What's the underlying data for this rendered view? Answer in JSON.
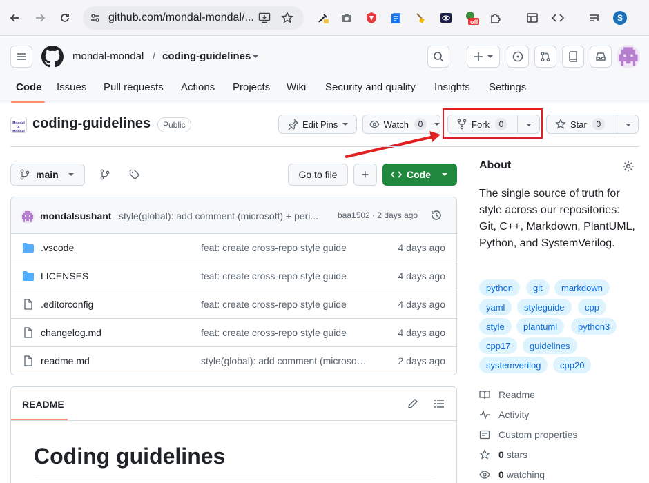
{
  "browser": {
    "url": "github.com/mondal-mondal/...",
    "profile_initial": "S",
    "ext_badge": "off"
  },
  "header": {
    "owner": "mondal-mondal",
    "separator": "/",
    "repo": "coding-guidelines"
  },
  "tabs": [
    {
      "label": "Code"
    },
    {
      "label": "Issues"
    },
    {
      "label": "Pull requests"
    },
    {
      "label": "Actions"
    },
    {
      "label": "Projects"
    },
    {
      "label": "Wiki"
    },
    {
      "label": "Security and quality"
    },
    {
      "label": "Insights"
    },
    {
      "label": "Settings"
    }
  ],
  "repo": {
    "logo_text_1": "Mondal &",
    "logo_text_2": "Mondal",
    "name": "coding-guidelines",
    "visibility": "Public",
    "edit_pins": "Edit Pins",
    "watch": "Watch",
    "watch_count": "0",
    "fork": "Fork",
    "fork_count": "0",
    "star": "Star",
    "star_count": "0"
  },
  "branch_bar": {
    "branch": "main",
    "go_to_file": "Go to file",
    "add": "+",
    "code": "Code"
  },
  "commit": {
    "author": "mondalsushant",
    "message": "style(global): add comment (microsoft) + peri...",
    "meta": "baa1502 · 2 days ago"
  },
  "files": [
    {
      "name": ".vscode",
      "type": "folder",
      "message": "feat: create cross-repo style guide",
      "date": "4 days ago"
    },
    {
      "name": "LICENSES",
      "type": "folder",
      "message": "feat: create cross-repo style guide",
      "date": "4 days ago"
    },
    {
      "name": ".editorconfig",
      "type": "file",
      "message": "feat: create cross-repo style guide",
      "date": "4 days ago"
    },
    {
      "name": "changelog.md",
      "type": "file",
      "message": "feat: create cross-repo style guide",
      "date": "4 days ago"
    },
    {
      "name": "readme.md",
      "type": "file",
      "message": "style(global): add comment (microsoft) + periods",
      "date": "2 days ago"
    }
  ],
  "readme": {
    "tab": "README",
    "heading": "Coding guidelines"
  },
  "about": {
    "title": "About",
    "description": "The single source of truth for style across our repositories: Git, C++, Markdown, PlantUML, Python, and SystemVerilog.",
    "topics": [
      "python",
      "git",
      "markdown",
      "yaml",
      "styleguide",
      "cpp",
      "style",
      "plantuml",
      "python3",
      "cpp17",
      "guidelines",
      "systemverilog",
      "cpp20"
    ],
    "links": [
      {
        "label": "Readme",
        "icon": "book-icon"
      },
      {
        "label": "Activity",
        "icon": "pulse-icon"
      },
      {
        "label": "Custom properties",
        "icon": "note-icon"
      },
      {
        "count": "0",
        "label": "stars",
        "icon": "star-icon"
      },
      {
        "count": "0",
        "label": "watching",
        "icon": "eye-icon"
      }
    ]
  },
  "colors": {
    "accent_green": "#1f883d",
    "tab_underline": "#fd8c73",
    "topic_bg": "#ddf4ff",
    "topic_fg": "#0969da",
    "annotation_red": "#e02020"
  }
}
